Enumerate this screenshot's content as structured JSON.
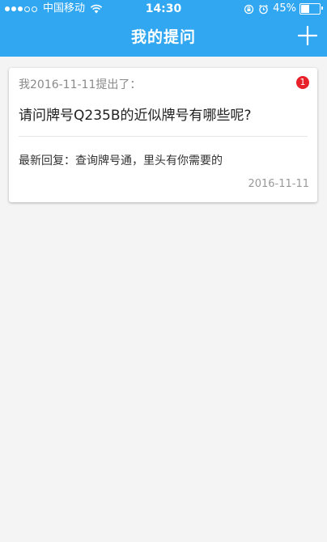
{
  "status_bar": {
    "carrier": "中国移动",
    "time": "14:30",
    "battery_percent": "45%",
    "battery_level": 0.45
  },
  "header": {
    "title": "我的提问",
    "add_icon": "plus-icon"
  },
  "question_card": {
    "asked_meta": "我2016-11-11提出了：",
    "badge_count": "1",
    "question": "请问牌号Q235B的近似牌号有哪些呢?",
    "latest_reply": "最新回复：查询牌号通，里头有你需要的",
    "reply_date": "2016-11-11"
  },
  "colors": {
    "brand": "#31a7f1",
    "badge": "#e8202a"
  }
}
